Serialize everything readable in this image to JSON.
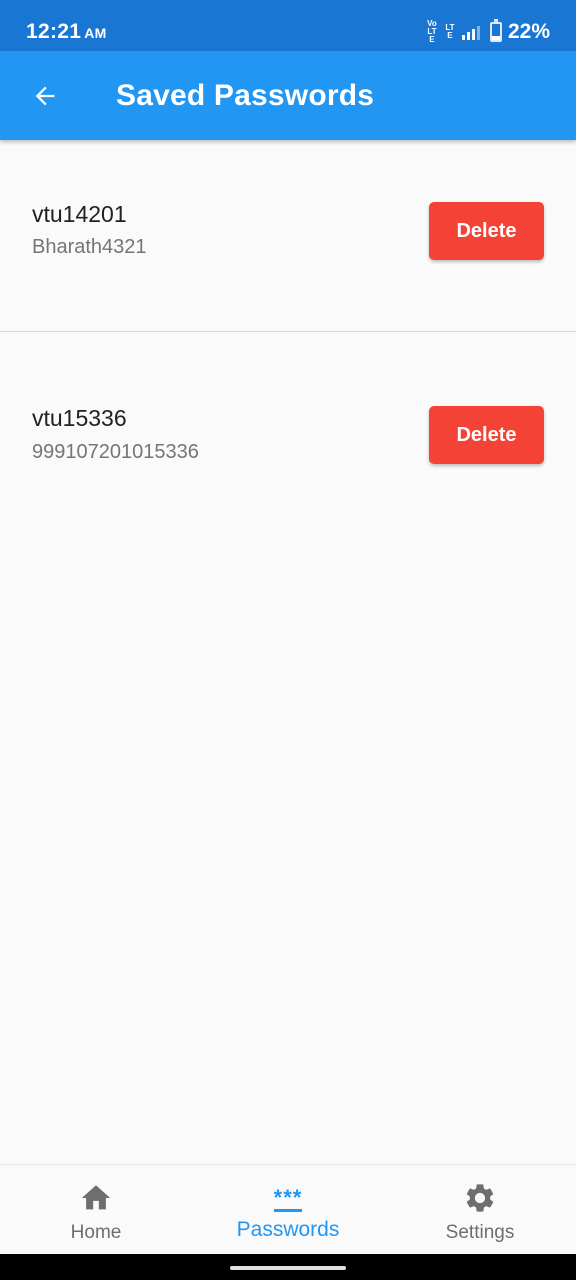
{
  "status_bar": {
    "time": "12:21",
    "ampm": "AM",
    "network_tag_1": "Vo LTE",
    "network_tag_2": "LTE",
    "battery_percent": "22%",
    "battery_level": 0.22
  },
  "app_bar": {
    "title": "Saved Passwords",
    "back_icon": "arrow-back-icon"
  },
  "entries": [
    {
      "title": "vtu14201",
      "subtitle": "Bharath4321",
      "delete_label": "Delete"
    },
    {
      "title": "vtu15336",
      "subtitle": "999107201015336",
      "delete_label": "Delete"
    }
  ],
  "bottom_nav": {
    "items": [
      {
        "label": "Home",
        "icon": "home-icon",
        "active": false
      },
      {
        "label": "Passwords",
        "icon": "asterisks-icon",
        "icon_text": "***",
        "active": true
      },
      {
        "label": "Settings",
        "icon": "gear-icon",
        "active": false
      }
    ]
  },
  "colors": {
    "status_bar": "#1976d2",
    "app_bar": "#2196f3",
    "delete_button": "#f44336",
    "active_nav": "#2196f3",
    "background": "#fafafa"
  }
}
